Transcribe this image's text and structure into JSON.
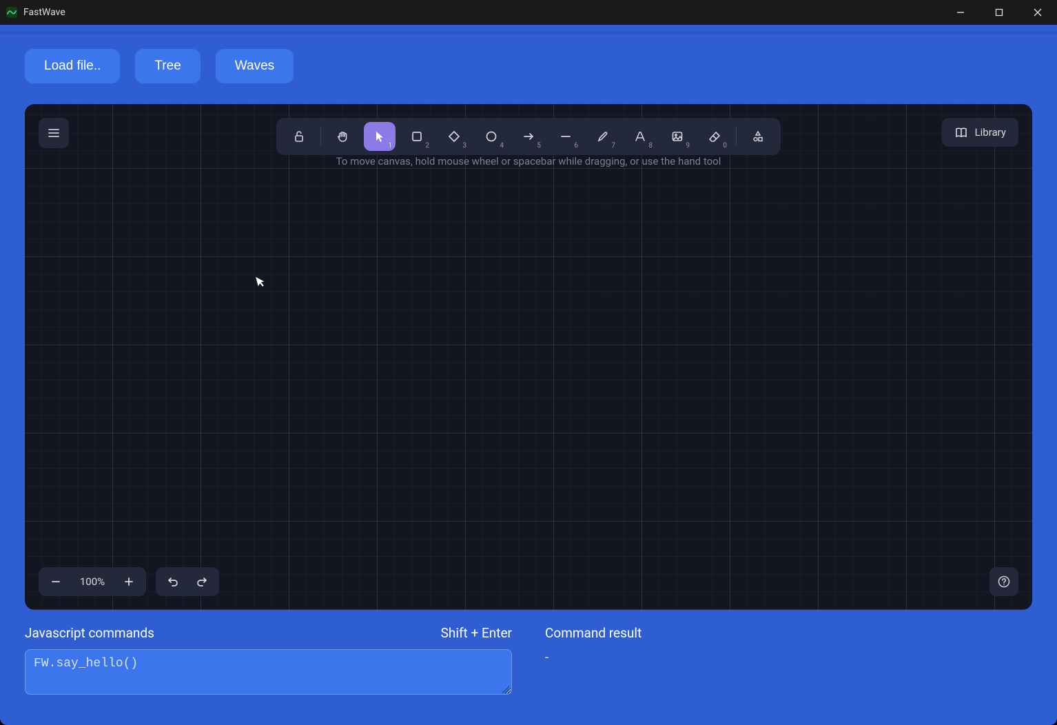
{
  "window": {
    "title": "FastWave"
  },
  "top_buttons": {
    "load": "Load file..",
    "tree": "Tree",
    "waves": "Waves"
  },
  "canvas": {
    "hint": "To move canvas, hold mouse wheel or spacebar while dragging, or use the hand tool",
    "library_label": "Library",
    "zoom_level": "100%",
    "tools": {
      "lock": "",
      "hand": "",
      "select": "1",
      "rect": "2",
      "diamond": "3",
      "ellipse": "4",
      "arrow": "5",
      "line": "6",
      "pencil": "7",
      "text": "8",
      "image": "9",
      "eraser": "0",
      "shapes": ""
    }
  },
  "commands": {
    "label": "Javascript commands",
    "hint": "Shift + Enter",
    "input_value": "FW.say_hello()",
    "result_label": "Command result",
    "result_value": "-"
  }
}
